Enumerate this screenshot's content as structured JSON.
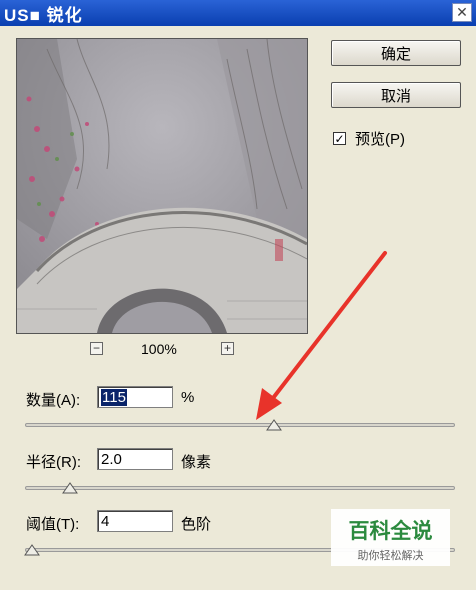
{
  "dialog": {
    "title": "US■ 锐化",
    "close_glyph": "✕"
  },
  "buttons": {
    "ok": "确定",
    "cancel": "取消"
  },
  "preview": {
    "label": "预览(P)",
    "checked": true,
    "check_glyph": "✓"
  },
  "zoom": {
    "minus": "−",
    "level": "100%",
    "plus": "+"
  },
  "params": [
    {
      "label": "数量(A):",
      "value": "115",
      "unit": "%",
      "slider_fraction": 0.58
    },
    {
      "label": "半径(R):",
      "value": "2.0",
      "unit": "像素",
      "slider_fraction": 0.105
    },
    {
      "label": "阈值(T):",
      "value": "4",
      "unit": "色阶",
      "slider_fraction": 0.016
    }
  ],
  "watermark": {
    "main": "百科全说",
    "sub": "助你轻松解决"
  },
  "colors": {
    "title_bar": "#0a3fb0",
    "arrow": "#e8332a",
    "selection": "#0a246a",
    "watermark_green": "#2b8a3e"
  }
}
